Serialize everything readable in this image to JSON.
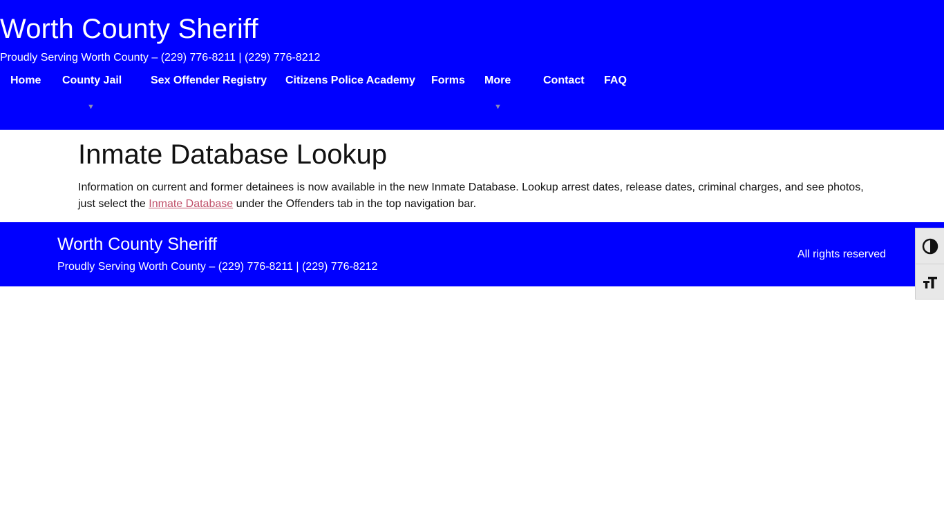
{
  "header": {
    "site_title": "Worth County Sheriff",
    "tagline": "Proudly Serving Worth County – (229) 776-8211 | (229) 776-8212",
    "background_color": "#0000ff"
  },
  "nav": {
    "items": [
      {
        "label": "Home"
      },
      {
        "label": "County Jail",
        "has_submenu": true
      },
      {
        "label": "Sex Offender Registry"
      },
      {
        "label": "Citizens Police Academy"
      },
      {
        "label": "Forms"
      },
      {
        "label": "More",
        "has_submenu": true
      },
      {
        "label": "Contact"
      },
      {
        "label": "FAQ"
      }
    ],
    "submenu_indicator": "▼"
  },
  "main": {
    "title": "Inmate Database Lookup",
    "paragraph_before_link": "Information on current and former detainees is now available in the new Inmate Database. Lookup arrest dates, release dates, criminal charges, and see photos, just select the ",
    "link_text": "Inmate Database",
    "paragraph_after_link": " under the Offenders tab in the top navigation bar.",
    "link_color": "#c0506a"
  },
  "footer": {
    "title": "Worth County Sheriff",
    "tagline": "Proudly Serving Worth County – (229) 776-8211 | (229) 776-8212",
    "rights": "All rights reserved"
  },
  "accessibility_toolbar": {
    "buttons": [
      {
        "icon": "contrast-icon"
      },
      {
        "icon": "text-size-icon"
      }
    ]
  }
}
